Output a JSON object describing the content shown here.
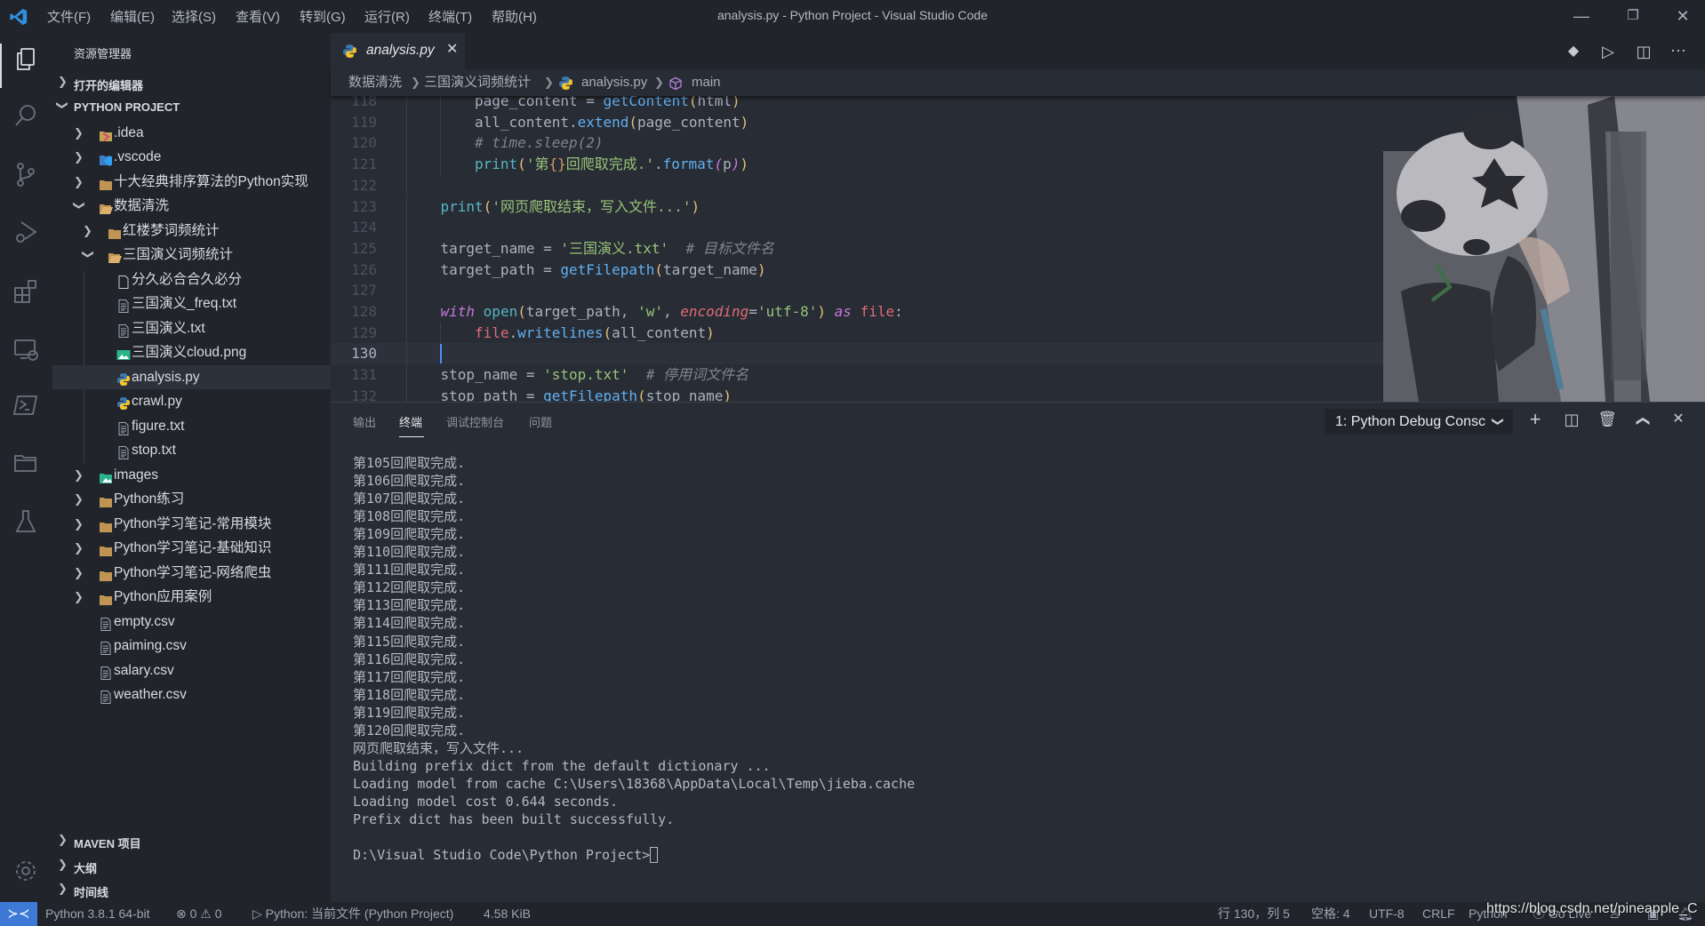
{
  "titlebar": {
    "title": "analysis.py - Python Project - Visual Studio Code",
    "menu": [
      "文件(F)",
      "编辑(E)",
      "选择(S)",
      "查看(V)",
      "转到(G)",
      "运行(R)",
      "终端(T)",
      "帮助(H)"
    ]
  },
  "sidebar": {
    "title": "资源管理器",
    "open_editors": "打开的编辑器",
    "project": "PYTHON PROJECT",
    "tree": [
      {
        "label": ".idea",
        "depth": 1,
        "icon": "idea-folder-icon",
        "chevron": "closed"
      },
      {
        "label": ".vscode",
        "depth": 1,
        "icon": "vscode-folder-icon",
        "chevron": "closed"
      },
      {
        "label": "十大经典排序算法的Python实现",
        "depth": 1,
        "icon": "folder-icon",
        "chevron": "closed"
      },
      {
        "label": "数据清洗",
        "depth": 1,
        "icon": "folder-open-icon",
        "chevron": "open"
      },
      {
        "label": "红楼梦词频统计",
        "depth": 2,
        "icon": "folder-icon",
        "chevron": "closed"
      },
      {
        "label": "三国演义词频统计",
        "depth": 2,
        "icon": "folder-open-icon",
        "chevron": "open"
      },
      {
        "label": "分久必合合久必分",
        "depth": 3,
        "icon": "blank-file-icon",
        "chevron": "none"
      },
      {
        "label": "三国演义_freq.txt",
        "depth": 3,
        "icon": "text-file-icon",
        "chevron": "none"
      },
      {
        "label": "三国演义.txt",
        "depth": 3,
        "icon": "text-file-icon",
        "chevron": "none"
      },
      {
        "label": "三国演义cloud.png",
        "depth": 3,
        "icon": "image-file-icon",
        "chevron": "none"
      },
      {
        "label": "analysis.py",
        "depth": 3,
        "icon": "python-file-icon",
        "chevron": "none",
        "selected": true
      },
      {
        "label": "crawl.py",
        "depth": 3,
        "icon": "python-file-icon",
        "chevron": "none"
      },
      {
        "label": "figure.txt",
        "depth": 3,
        "icon": "text-file-icon",
        "chevron": "none"
      },
      {
        "label": "stop.txt",
        "depth": 3,
        "icon": "text-file-icon",
        "chevron": "none"
      },
      {
        "label": "images",
        "depth": 1,
        "icon": "images-folder-icon",
        "chevron": "closed"
      },
      {
        "label": "Python练习",
        "depth": 1,
        "icon": "folder-icon",
        "chevron": "closed"
      },
      {
        "label": "Python学习笔记-常用模块",
        "depth": 1,
        "icon": "folder-icon",
        "chevron": "closed"
      },
      {
        "label": "Python学习笔记-基础知识",
        "depth": 1,
        "icon": "folder-icon",
        "chevron": "closed"
      },
      {
        "label": "Python学习笔记-网络爬虫",
        "depth": 1,
        "icon": "folder-icon",
        "chevron": "closed"
      },
      {
        "label": "Python应用案例",
        "depth": 1,
        "icon": "folder-icon",
        "chevron": "closed"
      },
      {
        "label": "empty.csv",
        "depth": 1,
        "icon": "text-file-icon",
        "chevron": "none"
      },
      {
        "label": "paiming.csv",
        "depth": 1,
        "icon": "text-file-icon",
        "chevron": "none"
      },
      {
        "label": "salary.csv",
        "depth": 1,
        "icon": "text-file-icon",
        "chevron": "none"
      },
      {
        "label": "weather.csv",
        "depth": 1,
        "icon": "text-file-icon",
        "chevron": "none"
      }
    ],
    "bottom_sections": [
      "MAVEN 项目",
      "大纲",
      "时间线"
    ]
  },
  "editor": {
    "tab_label": "analysis.py",
    "breadcrumb": [
      "数据清洗",
      "三国演义词频统计",
      "analysis.py",
      "main"
    ],
    "current_line": 130,
    "lines": [
      {
        "n": 118,
        "indent": 2,
        "tokens": [
          [
            "page_content ",
            "def"
          ],
          [
            "= ",
            "def"
          ],
          [
            "getContent",
            "fn"
          ],
          [
            "(",
            "br"
          ],
          [
            "html",
            "def"
          ],
          [
            ")",
            "br"
          ]
        ]
      },
      {
        "n": 119,
        "indent": 2,
        "tokens": [
          [
            "all_content.",
            "def"
          ],
          [
            "extend",
            "fn"
          ],
          [
            "(",
            "br"
          ],
          [
            "page_content",
            "def"
          ],
          [
            ")",
            "br"
          ]
        ]
      },
      {
        "n": 120,
        "indent": 2,
        "tokens": [
          [
            "# time.sleep(2)",
            "cm"
          ]
        ]
      },
      {
        "n": 121,
        "indent": 2,
        "tokens": [
          [
            "print",
            "print"
          ],
          [
            "(",
            "br"
          ],
          [
            "'第",
            "str"
          ],
          [
            "{}",
            "brace"
          ],
          [
            "回爬取完成.'",
            "str"
          ],
          [
            ".",
            "def"
          ],
          [
            "format",
            "fn"
          ],
          [
            "(",
            "kw"
          ],
          [
            "p",
            "def"
          ],
          [
            ")",
            "kw"
          ],
          [
            ")",
            "br"
          ]
        ]
      },
      {
        "n": 122,
        "indent": 0,
        "tokens": []
      },
      {
        "n": 123,
        "indent": 1,
        "tokens": [
          [
            "print",
            "print"
          ],
          [
            "(",
            "br"
          ],
          [
            "'网页爬取结束，写入文件...'",
            "str"
          ],
          [
            ")",
            "br"
          ]
        ]
      },
      {
        "n": 124,
        "indent": 0,
        "tokens": []
      },
      {
        "n": 125,
        "indent": 1,
        "tokens": [
          [
            "target_name = ",
            "def"
          ],
          [
            "'三国演义.txt'",
            "str"
          ],
          [
            "  # 目标文件名",
            "cm"
          ]
        ]
      },
      {
        "n": 126,
        "indent": 1,
        "tokens": [
          [
            "target_path = ",
            "def"
          ],
          [
            "getFilepath",
            "fn"
          ],
          [
            "(",
            "br"
          ],
          [
            "target_name",
            "def"
          ],
          [
            ")",
            "br"
          ]
        ]
      },
      {
        "n": 127,
        "indent": 0,
        "tokens": []
      },
      {
        "n": 128,
        "indent": 1,
        "tokens": [
          [
            "with",
            "kw"
          ],
          [
            " ",
            "def"
          ],
          [
            "open",
            "print"
          ],
          [
            "(",
            "br"
          ],
          [
            "target_path, ",
            "def"
          ],
          [
            "'w'",
            "str"
          ],
          [
            ", ",
            "def"
          ],
          [
            "encoding",
            "param"
          ],
          [
            "=",
            "def"
          ],
          [
            "'utf-8'",
            "str"
          ],
          [
            ")",
            "br"
          ],
          [
            " ",
            "def"
          ],
          [
            "as",
            "kw"
          ],
          [
            " ",
            "def"
          ],
          [
            "file",
            "var"
          ],
          [
            ":",
            "def"
          ]
        ]
      },
      {
        "n": 129,
        "indent": 2,
        "tokens": [
          [
            "file",
            "var"
          ],
          [
            ".",
            "def"
          ],
          [
            "writelines",
            "fn"
          ],
          [
            "(",
            "br"
          ],
          [
            "all_content",
            "def"
          ],
          [
            ")",
            "br"
          ]
        ]
      },
      {
        "n": 130,
        "indent": 0,
        "tokens": []
      },
      {
        "n": 131,
        "indent": 1,
        "tokens": [
          [
            "stop_name = ",
            "def"
          ],
          [
            "'stop.txt'",
            "str"
          ],
          [
            "  # 停用词文件名",
            "cm"
          ]
        ]
      },
      {
        "n": 132,
        "indent": 1,
        "tokens": [
          [
            "stop_path = ",
            "def"
          ],
          [
            "getFilepath",
            "fn"
          ],
          [
            "(",
            "br"
          ],
          [
            "stop_name",
            "def"
          ],
          [
            ")",
            "br"
          ]
        ]
      }
    ]
  },
  "panel": {
    "tabs": [
      "输出",
      "终端",
      "调试控制台",
      "问题"
    ],
    "active_tab": "终端",
    "terminal_select": "1: Python Debug Consc",
    "terminal_lines": [
      "第105回爬取完成.",
      "第106回爬取完成.",
      "第107回爬取完成.",
      "第108回爬取完成.",
      "第109回爬取完成.",
      "第110回爬取完成.",
      "第111回爬取完成.",
      "第112回爬取完成.",
      "第113回爬取完成.",
      "第114回爬取完成.",
      "第115回爬取完成.",
      "第116回爬取完成.",
      "第117回爬取完成.",
      "第118回爬取完成.",
      "第119回爬取完成.",
      "第120回爬取完成.",
      "网页爬取结束，写入文件...",
      "Building prefix dict from the default dictionary ...",
      "Loading model from cache C:\\Users\\18368\\AppData\\Local\\Temp\\jieba.cache",
      "Loading model cost 0.644 seconds.",
      "Prefix dict has been built successfully.",
      "",
      "D:\\Visual Studio Code\\Python Project>"
    ]
  },
  "statusbar": {
    "interpreter": "Python 3.8.1 64-bit",
    "errors": "0",
    "warnings": "0",
    "debug_config": "Python: 当前文件 (Python Project)",
    "file_size": "4.58 KiB",
    "position": "行 130，列 5",
    "indent": "空格: 4",
    "encoding": "UTF-8",
    "eol": "CRLF",
    "language": "Python",
    "live": "Go Live",
    "watermark": "https://blog.csdn.net/pineapple_C"
  },
  "colors": {
    "accent": "#528bff",
    "remote": "#3d7ad6",
    "string": "#98c379",
    "function": "#61afef",
    "keyword": "#c678dd"
  }
}
